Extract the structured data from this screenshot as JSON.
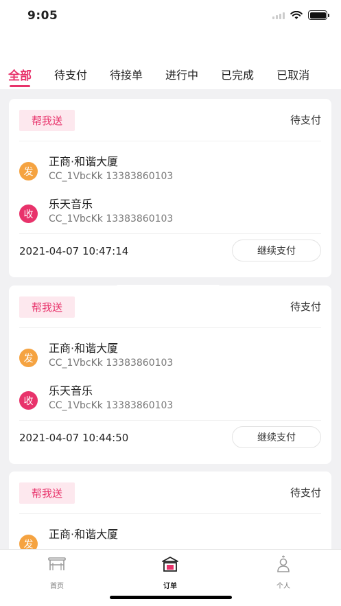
{
  "status_bar": {
    "time": "9:05"
  },
  "tabs": [
    {
      "label": "全部",
      "active": true
    },
    {
      "label": "待支付",
      "active": false
    },
    {
      "label": "待接单",
      "active": false
    },
    {
      "label": "进行中",
      "active": false
    },
    {
      "label": "已完成",
      "active": false
    },
    {
      "label": "已取消",
      "active": false
    }
  ],
  "orders": [
    {
      "type_tag": "帮我送",
      "status": "待支付",
      "sender": {
        "badge": "发",
        "name": "正商·和谐大厦",
        "contact": "CC_1VbcKk 13383860103"
      },
      "receiver": {
        "badge": "收",
        "name": "乐天音乐",
        "contact": "CC_1VbcKk 13383860103"
      },
      "date": "2021-04-07 10:47:14",
      "action_label": "继续支付"
    },
    {
      "type_tag": "帮我送",
      "status": "待支付",
      "sender": {
        "badge": "发",
        "name": "正商·和谐大厦",
        "contact": "CC_1VbcKk 13383860103"
      },
      "receiver": {
        "badge": "收",
        "name": "乐天音乐",
        "contact": "CC_1VbcKk 13383860103"
      },
      "date": "2021-04-07 10:44:50",
      "action_label": "继续支付"
    },
    {
      "type_tag": "帮我送",
      "status": "待支付",
      "sender": {
        "badge": "发",
        "name": "正商·和谐大厦"
      }
    }
  ],
  "bottom_nav": [
    {
      "label": "首页",
      "icon": "home-icon",
      "active": false
    },
    {
      "label": "订单",
      "icon": "order-icon",
      "active": true
    },
    {
      "label": "个人",
      "icon": "person-icon",
      "active": false
    }
  ],
  "colors": {
    "accent": "#e8336b",
    "send_badge": "#f5a341",
    "tag_bg": "#fde8ee"
  }
}
